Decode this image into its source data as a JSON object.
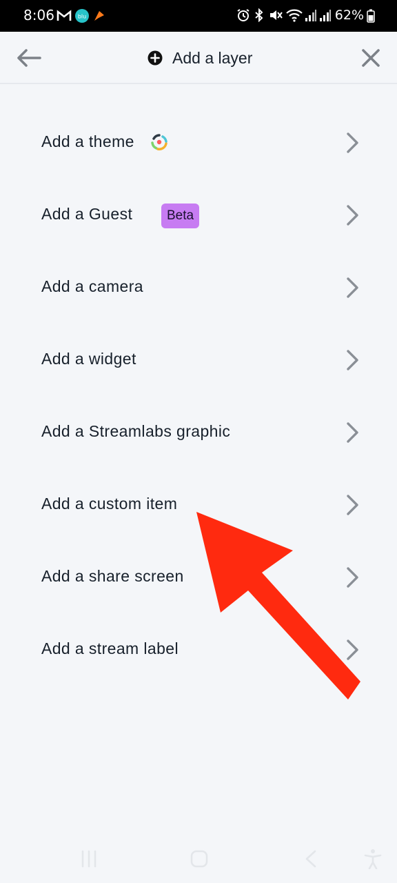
{
  "status_bar": {
    "time": "8:06",
    "battery": "62%",
    "icons": [
      "gmail-icon",
      "blu-icon",
      "app-icon",
      "alarm-icon",
      "bluetooth-icon",
      "mute-icon",
      "wifi-icon",
      "signal-icon",
      "signal-icon",
      "battery-icon"
    ]
  },
  "header": {
    "title": "Add a layer",
    "icons": {
      "back": "arrow-left-icon",
      "title": "plus-circle-icon",
      "close": "close-icon"
    }
  },
  "menu": {
    "items": [
      {
        "label": "Add a theme"
      },
      {
        "label": "Add a Guest",
        "badge": "Beta"
      },
      {
        "label": "Add a camera"
      },
      {
        "label": "Add a widget"
      },
      {
        "label": "Add a Streamlabs graphic"
      },
      {
        "label": "Add a custom item"
      },
      {
        "label": "Add a share screen"
      },
      {
        "label": "Add a stream label"
      }
    ]
  },
  "colors": {
    "background": "#f4f6f9",
    "text": "#17202b",
    "chevron": "#8a8f96",
    "beta_badge": "#c77cf2",
    "annotation_arrow": "#ff2a0f"
  },
  "nav_bar": {
    "icons": [
      "recent-apps-icon",
      "home-icon",
      "back-icon",
      "accessibility-icon"
    ]
  }
}
